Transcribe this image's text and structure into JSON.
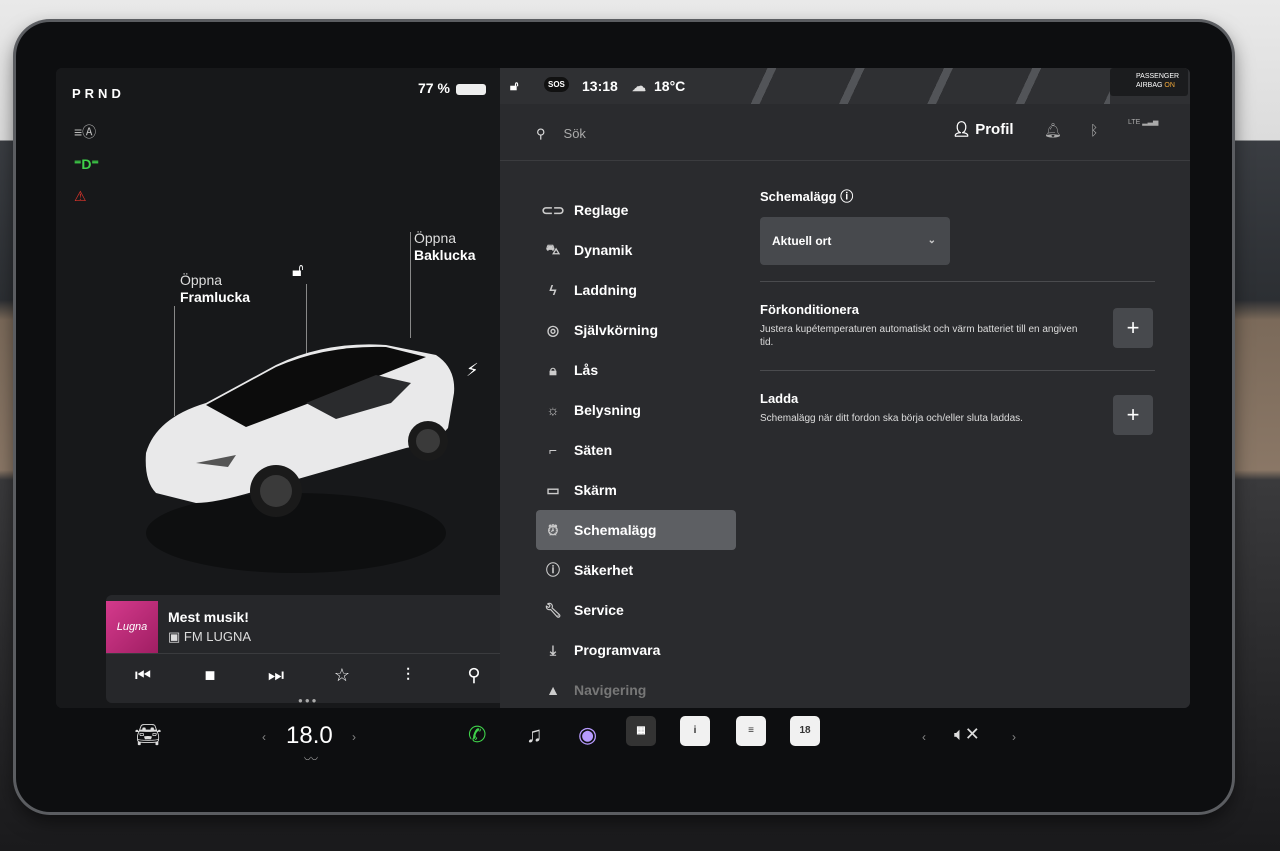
{
  "left": {
    "gear": "PRND",
    "battery": "77 %",
    "frunk": {
      "line1": "Öppna",
      "line2": "Framlucka"
    },
    "trunk": {
      "line1": "Öppna",
      "line2": "Baklucka"
    }
  },
  "media": {
    "art": "Lugna",
    "title": "Mest musik!",
    "station": "FM LUGNA"
  },
  "status": {
    "time": "13:18",
    "temp": "18°C",
    "sos": "SOS",
    "airbag": {
      "line1": "PASSENGER",
      "line2": "AIRBAG",
      "state": "ON"
    }
  },
  "topbar": {
    "search_placeholder": "Sök",
    "profile": "Profil",
    "lte": "LTE"
  },
  "menu": [
    {
      "label": "Reglage",
      "icon": "toggle-icon"
    },
    {
      "label": "Dynamik",
      "icon": "car-icon"
    },
    {
      "label": "Laddning",
      "icon": "bolt-icon"
    },
    {
      "label": "Självkörning",
      "icon": "steering-icon"
    },
    {
      "label": "Lås",
      "icon": "lock-icon"
    },
    {
      "label": "Belysning",
      "icon": "sun-icon"
    },
    {
      "label": "Säten",
      "icon": "seat-icon"
    },
    {
      "label": "Skärm",
      "icon": "display-icon"
    },
    {
      "label": "Schemalägg",
      "icon": "alarm-icon",
      "active": true
    },
    {
      "label": "Säkerhet",
      "icon": "info-circle-icon"
    },
    {
      "label": "Service",
      "icon": "wrench-icon"
    },
    {
      "label": "Programvara",
      "icon": "download-icon"
    },
    {
      "label": "Navigering",
      "icon": "nav-arrow-icon"
    }
  ],
  "content": {
    "heading": "Schemalägg",
    "dropdown_value": "Aktuell ort",
    "precondition_title": "Förkonditionera",
    "precondition_desc": "Justera kupétemperaturen automatiskt och värm batteriet till en angiven tid.",
    "charge_title": "Ladda",
    "charge_desc": "Schemalägg när ditt fordon ska börja och/eller sluta laddas.",
    "plus": "+"
  },
  "dock": {
    "temperature": "18.0",
    "calendar_day": "18"
  }
}
